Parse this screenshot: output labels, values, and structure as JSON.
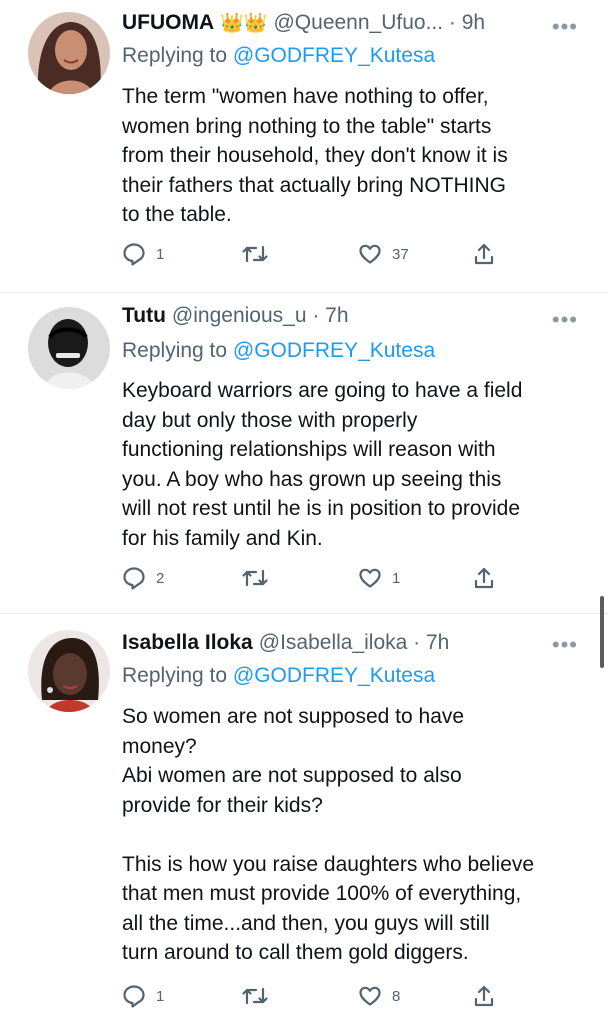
{
  "tweets": [
    {
      "name": "UFUOMA",
      "badges": "👑👑",
      "handle_time": "@Queenn_Ufuo... · 9h",
      "reply_prefix": "Replying to",
      "reply_to": "@GODFREY_Kutesa",
      "text": "The term \"women have nothing to offer,\nwomen bring nothing to the table\" starts\nfrom their household, they don't know it is\ntheir fathers that actually bring NOTHING\nto the table.",
      "replies": "1",
      "retweets": "",
      "likes": "37",
      "avatar_colors": [
        "#c98f72",
        "#4a2c25"
      ]
    },
    {
      "name": "Tutu",
      "badges": "",
      "handle_time": "@ingenious_u · 7h",
      "reply_prefix": "Replying to",
      "reply_to": "@GODFREY_Kutesa",
      "text": "Keyboard warriors are going to have a field\nday but only those with properly\nfunctioning relationships will reason with\nyou. A boy who has grown up seeing this\nwill not rest until he is in position to provide\nfor his family and Kin.",
      "replies": "2",
      "retweets": "",
      "likes": "1",
      "avatar_colors": [
        "#d8d8d8",
        "#1a1a1a"
      ]
    },
    {
      "name": "Isabella Iloka",
      "badges": "",
      "handle_time": "@Isabella_iloka · 7h",
      "reply_prefix": "Replying to",
      "reply_to": "@GODFREY_Kutesa",
      "text": "So women are not supposed to have\nmoney?\nAbi women are not supposed to also\nprovide for their kids?\n\nThis is how you raise daughters who believe\nthat men must provide 100% of everything,\nall the time...and then, you guys will still\nturn around to call them gold diggers.",
      "replies": "1",
      "retweets": "",
      "likes": "8",
      "avatar_colors": [
        "#e7d3cf",
        "#5a3a2e"
      ]
    }
  ],
  "icons": {
    "more": "more-icon",
    "reply": "reply-icon",
    "retweet": "retweet-icon",
    "like": "like-icon",
    "share": "share-icon"
  }
}
